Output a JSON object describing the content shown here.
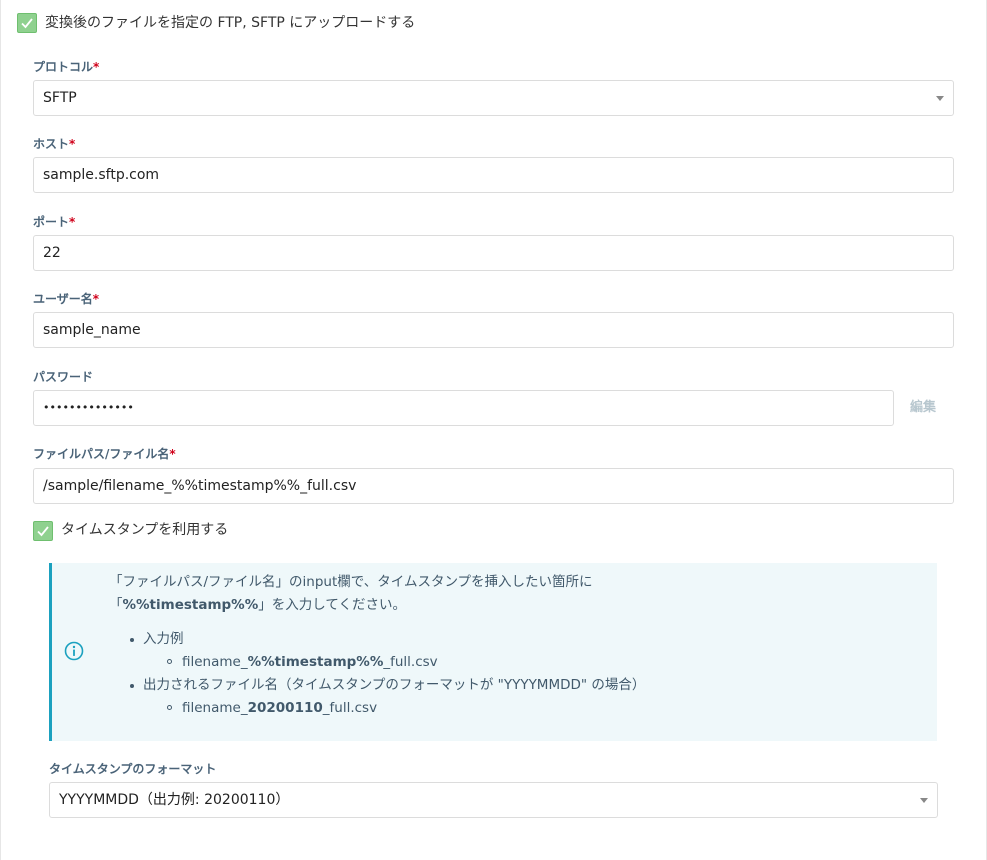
{
  "upload": {
    "checkbox_label": "変換後のファイルを指定の FTP, SFTP にアップロードする",
    "checked": true
  },
  "form": {
    "required_mark": "*",
    "protocol": {
      "label": "プロトコル",
      "value": "SFTP"
    },
    "host": {
      "label": "ホスト",
      "value": "sample.sftp.com"
    },
    "port": {
      "label": "ポート",
      "value": "22"
    },
    "username": {
      "label": "ユーザー名",
      "value": "sample_name"
    },
    "password": {
      "label": "パスワード",
      "value": "••••••••••••••",
      "edit_label": "編集"
    },
    "filepath": {
      "label": "ファイルパス/ファイル名",
      "value": "/sample/filename_%%timestamp%%_full.csv"
    }
  },
  "timestamp": {
    "checkbox_label": "タイムスタンプを利用する",
    "checked": true,
    "info": {
      "line1": "「ファイルパス/ファイル名」のinput欄で、タイムスタンプを挿入したい箇所に",
      "line2_open": "「",
      "line2_bold": "%%timestamp%%",
      "line2_rest": "」を入力してください。",
      "example_heading": "入力例",
      "example_prefix": "filename_",
      "example_bold": "%%timestamp%%",
      "example_suffix": "_full.csv",
      "output_heading": "出力されるファイル名（タイムスタンプのフォーマットが \"YYYYMMDD\" の場合）",
      "output_prefix": "filename_",
      "output_bold": "20200110",
      "output_suffix": "_full.csv"
    },
    "format_label": "タイムスタンプのフォーマット",
    "format_value": "YYYYMMDD（出力例: 20200110）"
  },
  "colors": {
    "accent": "#1ba1bf",
    "checkbox": "#8fd18f",
    "required": "#d0021b",
    "label": "#4a6378"
  },
  "icons": {
    "checkbox": "check-icon",
    "info": "info-circle-icon",
    "select": "caret-down-icon"
  }
}
